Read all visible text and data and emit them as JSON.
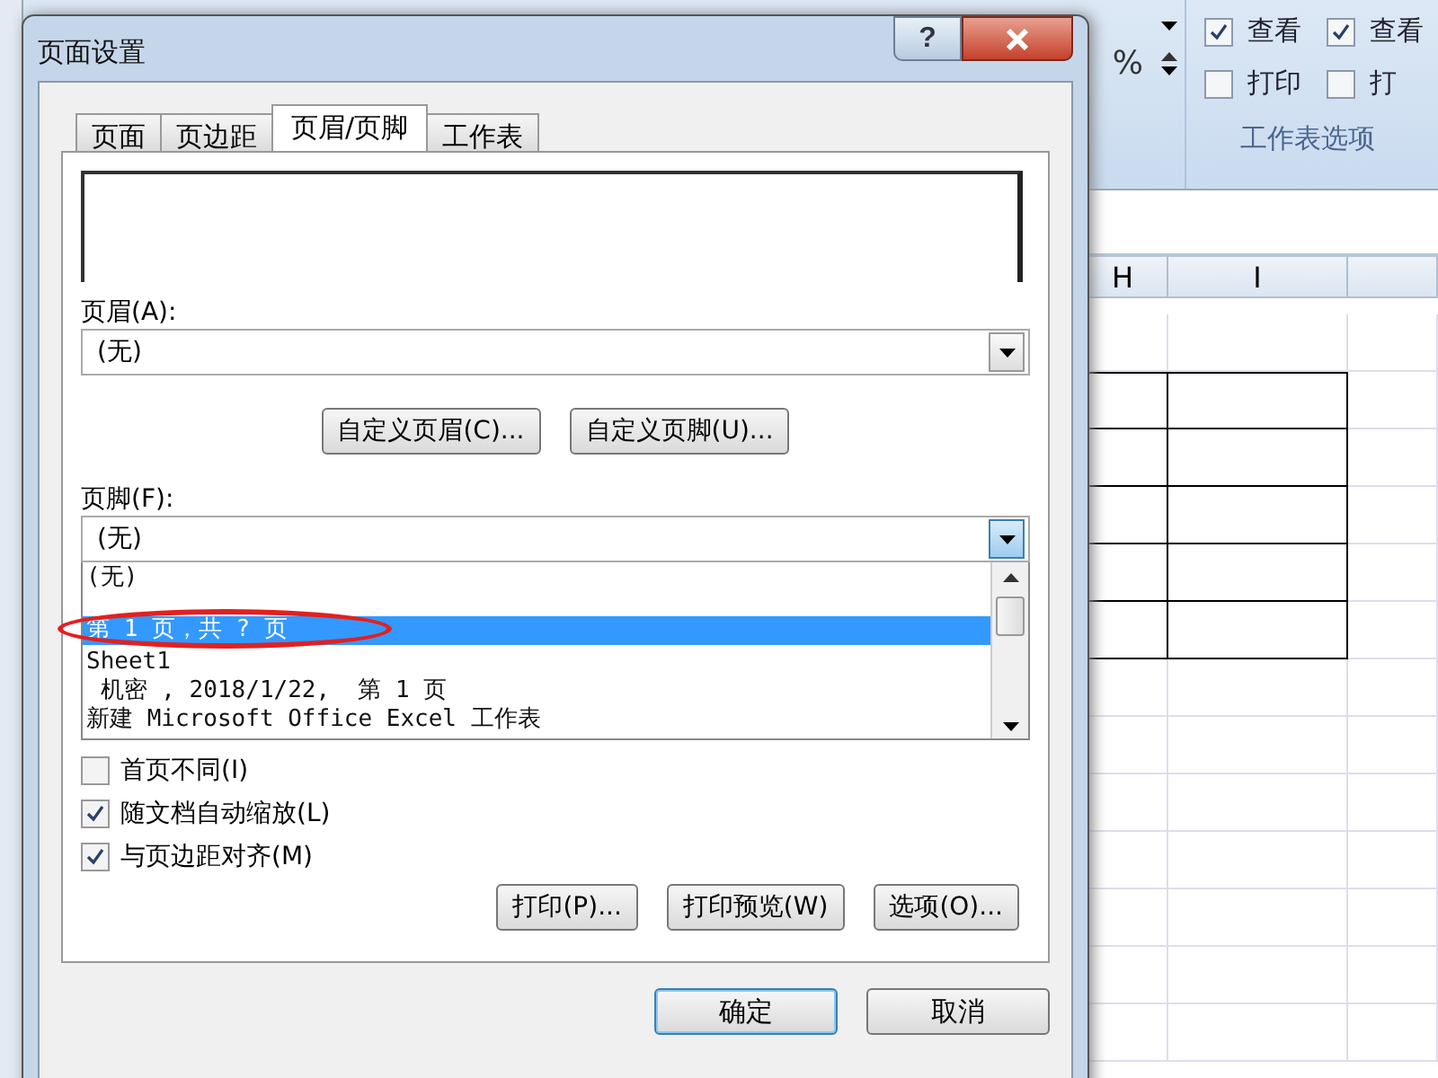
{
  "ribbon": {
    "zoom_suffix": "%",
    "options": [
      {
        "label": "查看",
        "checked": true
      },
      {
        "label": "打印",
        "checked": false
      }
    ],
    "options_cut": [
      {
        "label": "查看",
        "checked": true
      },
      {
        "label": "打",
        "checked": false
      }
    ],
    "group_label": "工作表选项"
  },
  "sheet": {
    "columns": [
      "H",
      "I"
    ]
  },
  "dialog": {
    "title": "页面设置",
    "help_button": "?",
    "tabs": [
      {
        "label": "页面",
        "selected": false
      },
      {
        "label": "页边距",
        "selected": false
      },
      {
        "label": "页眉/页脚",
        "selected": true
      },
      {
        "label": "工作表",
        "selected": false
      }
    ],
    "header_label": "页眉(A):",
    "header_value": "(无)",
    "custom_buttons": [
      "自定义页眉(C)...",
      "自定义页脚(U)..."
    ],
    "footer_label": "页脚(F):",
    "footer_value": "(无)",
    "footer_options": [
      {
        "label": "(无)",
        "selected": false
      },
      {
        "label": "第 1 页，共 ? 页",
        "selected": true
      },
      {
        "label": "Sheet1",
        "selected": false
      },
      {
        "label": " 机密 , 2018/1/22,  第 1 页",
        "selected": false
      },
      {
        "label": "新建 Microsoft Office Excel 工作表",
        "selected": false
      }
    ],
    "checkboxes": [
      {
        "label": "首页不同(I)",
        "checked": false
      },
      {
        "label": "随文档自动缩放(L)",
        "checked": true
      },
      {
        "label": "与页边距对齐(M)",
        "checked": true
      }
    ],
    "buttons": [
      "打印(P)...",
      "打印预览(W)",
      "选项(O)..."
    ],
    "footer_buttons": [
      {
        "label": "确定",
        "default": true
      },
      {
        "label": "取消",
        "default": false
      }
    ]
  }
}
